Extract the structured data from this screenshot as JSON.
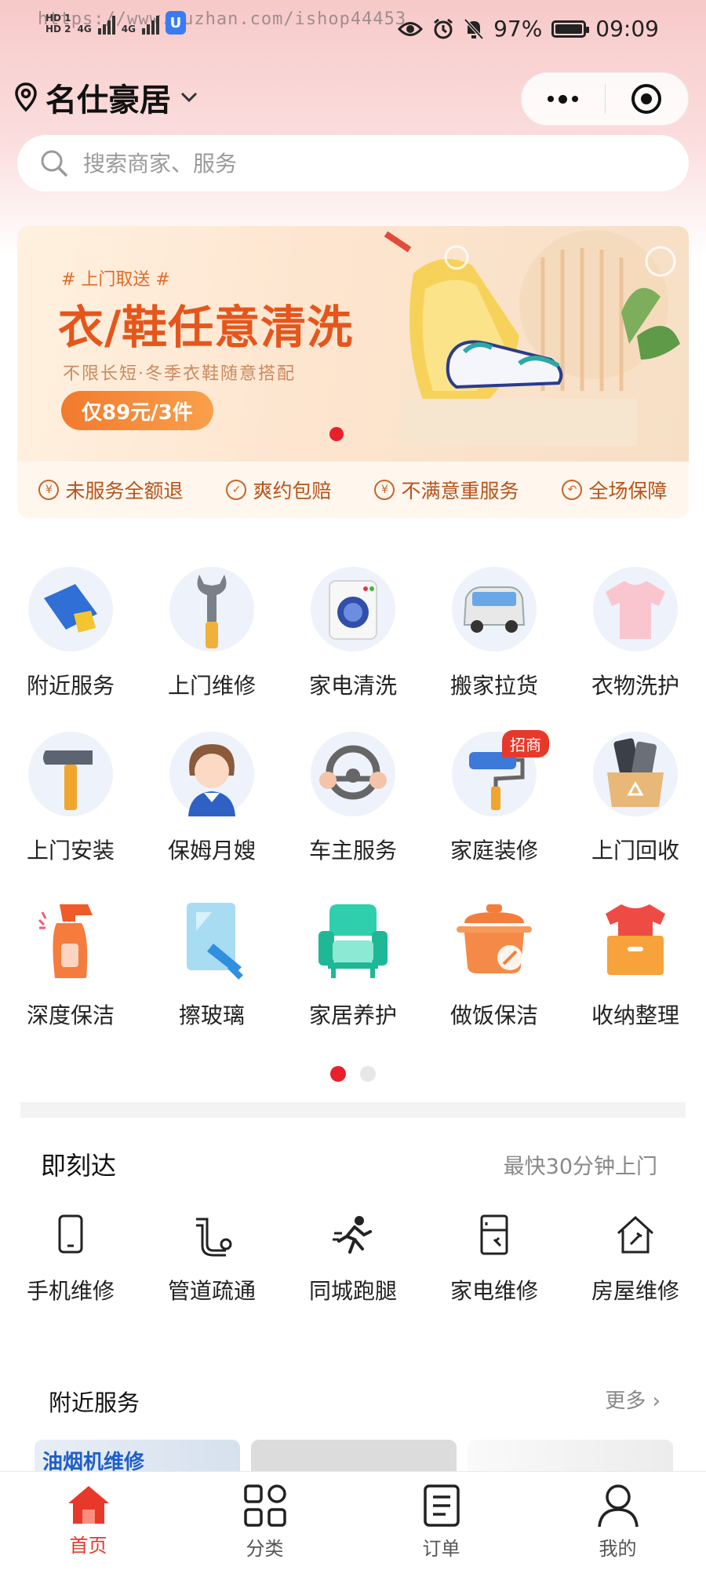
{
  "status_bar": {
    "watermark": "https://www.huzhan.com/ishop44453",
    "network_labels": [
      "HD 1",
      "HD 2",
      "4G",
      "4G"
    ],
    "battery": "97%",
    "time": "09:09"
  },
  "header": {
    "location": "名仕豪居"
  },
  "search": {
    "placeholder": "搜索商家、服务"
  },
  "banner": {
    "tag": "# 上门取送 #",
    "title": "衣/鞋任意清洗",
    "subtitle": "不限长短·冬季衣鞋随意搭配",
    "button": "仅89元/3件",
    "guarantees": [
      "未服务全额退",
      "爽约包赔",
      "不满意重服务",
      "全场保障"
    ]
  },
  "categories": [
    [
      {
        "label": "附近服务",
        "icon": "cloth-icon"
      },
      {
        "label": "上门维修",
        "icon": "wrench-icon"
      },
      {
        "label": "家电清洗",
        "icon": "washing-machine-icon"
      },
      {
        "label": "搬家拉货",
        "icon": "van-icon"
      },
      {
        "label": "衣物洗护",
        "icon": "shirt-icon"
      }
    ],
    [
      {
        "label": "上门安装",
        "icon": "hammer-icon"
      },
      {
        "label": "保姆月嫂",
        "icon": "nanny-icon"
      },
      {
        "label": "车主服务",
        "icon": "steering-wheel-icon"
      },
      {
        "label": "家庭装修",
        "icon": "paint-roller-icon",
        "badge": "招商"
      },
      {
        "label": "上门回收",
        "icon": "recycle-box-icon"
      }
    ],
    [
      {
        "label": "深度保洁",
        "icon": "spray-bottle-icon"
      },
      {
        "label": "擦玻璃",
        "icon": "window-wiper-icon"
      },
      {
        "label": "家居养护",
        "icon": "armchair-icon"
      },
      {
        "label": "做饭保洁",
        "icon": "cooking-pot-icon"
      },
      {
        "label": "收纳整理",
        "icon": "storage-box-icon"
      }
    ]
  ],
  "instant": {
    "title": "即刻达",
    "subtitle": "最快30分钟上门",
    "items": [
      {
        "label": "手机维修",
        "icon": "phone-icon"
      },
      {
        "label": "管道疏通",
        "icon": "pipe-icon"
      },
      {
        "label": "同城跑腿",
        "icon": "runner-icon"
      },
      {
        "label": "家电维修",
        "icon": "appliance-icon"
      },
      {
        "label": "房屋维修",
        "icon": "house-repair-icon"
      }
    ]
  },
  "nearby": {
    "title": "附近服务",
    "more": "更多 ›",
    "card_label": "油烟机维修"
  },
  "tabbar": {
    "items": [
      {
        "label": "首页",
        "icon": "home-icon",
        "active": true
      },
      {
        "label": "分类",
        "icon": "grid-icon",
        "active": false
      },
      {
        "label": "订单",
        "icon": "order-icon",
        "active": false
      },
      {
        "label": "我的",
        "icon": "user-icon",
        "active": false
      }
    ]
  },
  "colors": {
    "accent": "#e8202a",
    "banner_orange": "#e5561c",
    "header_pink": "#f7c9c9"
  }
}
